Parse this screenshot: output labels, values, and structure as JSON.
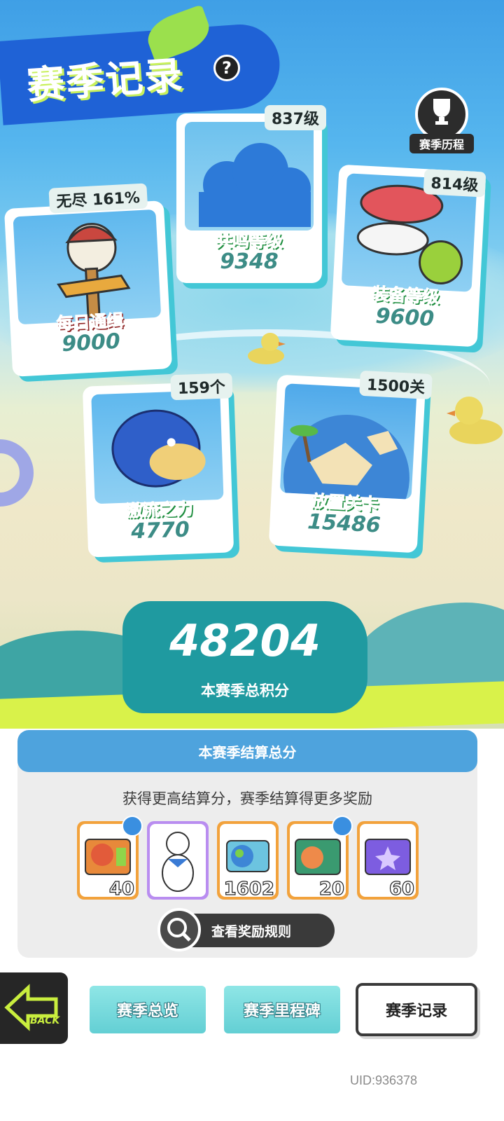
{
  "header": {
    "title": "赛季记录",
    "help_icon": "question-mark-icon",
    "history_label": "赛季历程"
  },
  "cards": {
    "daily_wanted": {
      "tag": "无尽 161%",
      "name": "每日通缉",
      "score": "9000"
    },
    "resonance": {
      "tag": "837级",
      "name": "共鸣等级",
      "score": "9348"
    },
    "equipment": {
      "tag": "814级",
      "name": "装备等级",
      "score": "9600"
    },
    "torrent": {
      "tag": "159个",
      "name": "激流之力",
      "score": "4770"
    },
    "idle_stage": {
      "tag": "1500关",
      "name": "放置关卡",
      "score": "15486"
    }
  },
  "total": {
    "value": "48204",
    "label": "本赛季总积分"
  },
  "settlement": {
    "title": "本赛季结算总分",
    "subtitle": "获得更高结算分，赛季结算得更多奖励",
    "rewards": [
      {
        "icon": "lion-dance-ticket-icon",
        "count": "40",
        "frame": "#f2a23c"
      },
      {
        "icon": "polar-bear-sailor-icon",
        "count": "",
        "frame": "#b98df0"
      },
      {
        "icon": "earth-card-icon",
        "count": "1602",
        "frame": "#f2a23c"
      },
      {
        "icon": "peach-ticket-icon",
        "count": "20",
        "frame": "#f2a23c"
      },
      {
        "icon": "purple-star-ticket-icon",
        "count": "60",
        "frame": "#f2a23c"
      }
    ],
    "rules_button": "查看奖励规则"
  },
  "nav": {
    "back_label": "BACK",
    "tabs": [
      "赛季总览",
      "赛季里程碑",
      "赛季记录"
    ],
    "active_tab": "赛季记录"
  },
  "uid": "UID:936378",
  "colors": {
    "accent_blue": "#1f62d6",
    "card_shadow": "#43c7d6",
    "lime": "#d9f24a",
    "teal": "#1f9aa0"
  }
}
